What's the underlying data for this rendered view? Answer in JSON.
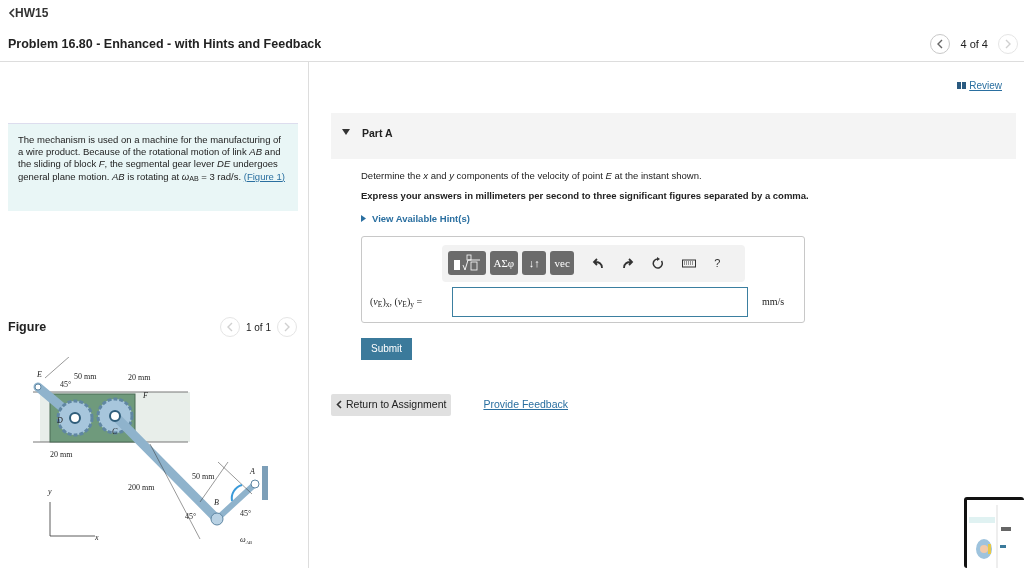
{
  "header": {
    "back_link": "HW15",
    "title": "Problem 16.80 - Enhanced - with Hints and Feedback",
    "pager": "4 of 4",
    "prev_disabled": false,
    "next_disabled": true
  },
  "review_link": "Review",
  "problem": {
    "text": "The mechanism is used on a machine for the manufacturing of a wire product. Because of the rotational motion of link *AB* and the sliding of block *F*, the segmental gear lever *DE* undergoes general plane motion. *AB* is rotating at *ω*$_{AB}$ = 3 rad/s.",
    "figure_link": "(Figure 1)"
  },
  "figure": {
    "heading": "Figure",
    "pager": "1 of 1",
    "prev_disabled": true,
    "next_disabled": true,
    "labels": [
      "E",
      "50 mm",
      "45°",
      "20 mm",
      "F",
      "D",
      "C",
      "20 mm",
      "50 mm",
      "A",
      "200 mm",
      "B",
      "45°",
      "45°",
      "ω$_{AB}$",
      "y",
      "x"
    ]
  },
  "part": {
    "title": "Part A",
    "expanded": true,
    "question": "Determine the *x* and *y* components of the velocity of point *E* at the instant shown.",
    "instruction": "Express your answers in millimeters per second to three significant figures separated by a comma.",
    "hints_link": "View Available Hint(s)",
    "toolbar": [
      {
        "kind": "template"
      },
      {
        "kind": "dark",
        "label": "ΑΣφ"
      },
      {
        "kind": "dark",
        "label": "↓↑"
      },
      {
        "kind": "dark",
        "label": "vec"
      },
      {
        "kind": "undo"
      },
      {
        "kind": "redo"
      },
      {
        "kind": "reset"
      },
      {
        "kind": "keyboard"
      },
      {
        "kind": "plain",
        "label": "?"
      }
    ],
    "answer_label": "(*v*$_{E}$)$_{x}$, (*v*$_{E}$)$_{y}$ =",
    "unit": "mm/s",
    "submit": "Submit"
  },
  "footer": {
    "return": "Return to Assignment",
    "feedback": "Provide Feedback"
  }
}
